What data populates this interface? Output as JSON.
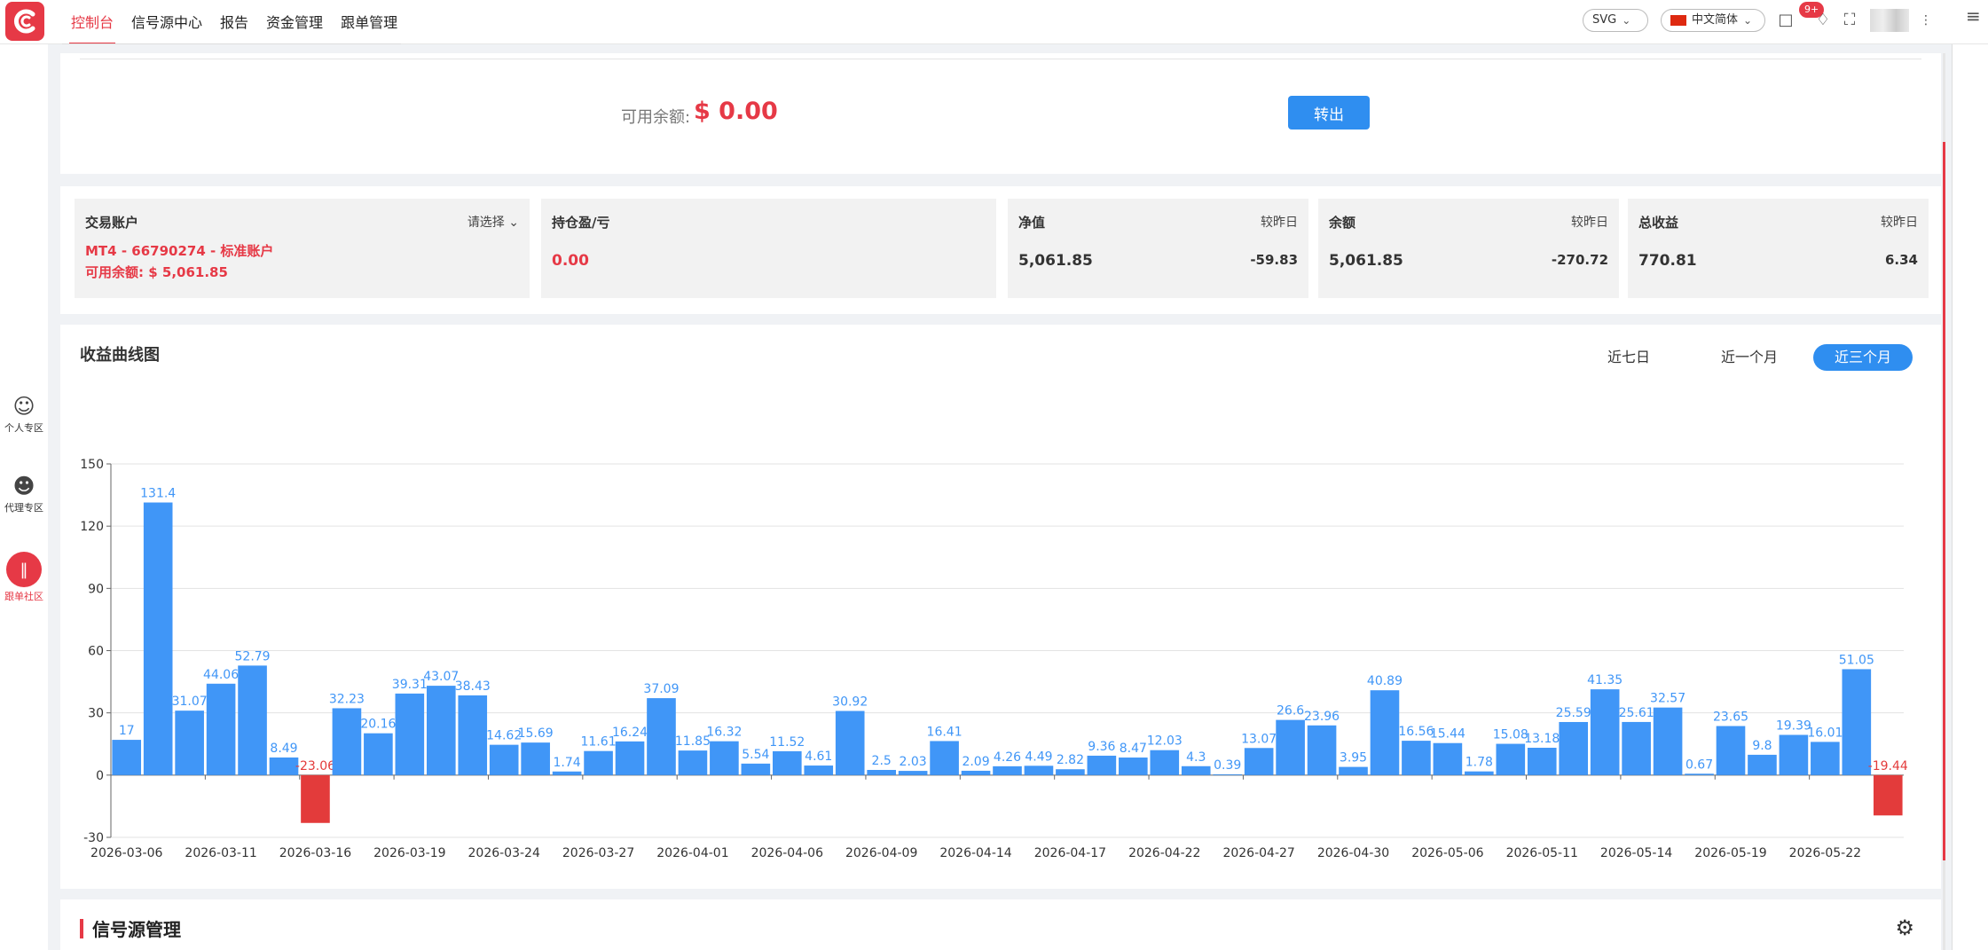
{
  "nav": {
    "items": [
      "控制台",
      "信号源中心",
      "报告",
      "资金管理",
      "跟单管理"
    ],
    "active_index": 0
  },
  "topbar": {
    "render_mode": "SVG",
    "language": "中文简体",
    "notification_count": "9+"
  },
  "sidebar": {
    "items": [
      {
        "label": "个人专区",
        "icon": "user-icon"
      },
      {
        "label": "代理专区",
        "icon": "group-icon"
      },
      {
        "label": "跟单社区",
        "icon": "candlestick-icon"
      }
    ]
  },
  "transfer": {
    "available_label": "可用余额:",
    "available_value": "$ 0.00",
    "button_label": "转出"
  },
  "stats": {
    "account": {
      "title": "交易账户",
      "select_label": "请选择",
      "account_line": "MT4 - 66790274 - 标准账户",
      "balance_line": "可用余额: $ 5,061.85"
    },
    "floating_pl": {
      "title": "持仓盈/亏",
      "value": "0.00"
    },
    "equity": {
      "title": "净值",
      "compare_label": "较昨日",
      "value": "5,061.85",
      "delta": "-59.83"
    },
    "balance": {
      "title": "余额",
      "compare_label": "较昨日",
      "value": "5,061.85",
      "delta": "-270.72"
    },
    "total_profit": {
      "title": "总收益",
      "compare_label": "较昨日",
      "value": "770.81",
      "delta": "6.34"
    }
  },
  "chart_panel": {
    "title": "收益曲线图",
    "ranges": [
      "近七日",
      "近一个月",
      "近三个月"
    ],
    "active_range": 2
  },
  "chart_data": {
    "type": "bar",
    "title": "收益曲线图",
    "xlabel": "",
    "ylabel": "",
    "ylim": [
      -30,
      150
    ],
    "yticks": [
      150,
      120,
      90,
      60,
      30,
      0,
      -30
    ],
    "xtick_labels": [
      "2026-03-06",
      "2026-03-11",
      "2026-03-16",
      "2026-03-19",
      "2026-03-24",
      "2026-03-27",
      "2026-04-01",
      "2026-04-06",
      "2026-04-09",
      "2026-04-14",
      "2026-04-17",
      "2026-04-22",
      "2026-04-27",
      "2026-04-30",
      "2026-05-06",
      "2026-05-11",
      "2026-05-14",
      "2026-05-19",
      "2026-05-22"
    ],
    "values": [
      17,
      131.4,
      31.07,
      44.06,
      52.79,
      8.49,
      -23.06,
      32.23,
      20.16,
      39.31,
      43.07,
      38.43,
      14.62,
      15.69,
      1.74,
      11.61,
      16.24,
      37.09,
      11.85,
      16.32,
      5.54,
      11.52,
      4.61,
      30.92,
      2.5,
      2.03,
      16.41,
      2.09,
      4.26,
      4.49,
      2.82,
      9.36,
      8.47,
      12.03,
      4.3,
      0.39,
      13.07,
      26.6,
      23.96,
      3.95,
      40.89,
      16.56,
      15.44,
      1.78,
      15.08,
      13.18,
      25.59,
      41.35,
      25.61,
      32.57,
      0.67,
      23.65,
      9.8,
      19.39,
      16.01,
      51.05,
      -19.44
    ],
    "positive_color": "#4096f7",
    "negative_color": "#e33b3b",
    "grid": true
  },
  "signal_section": {
    "title": "信号源管理"
  }
}
